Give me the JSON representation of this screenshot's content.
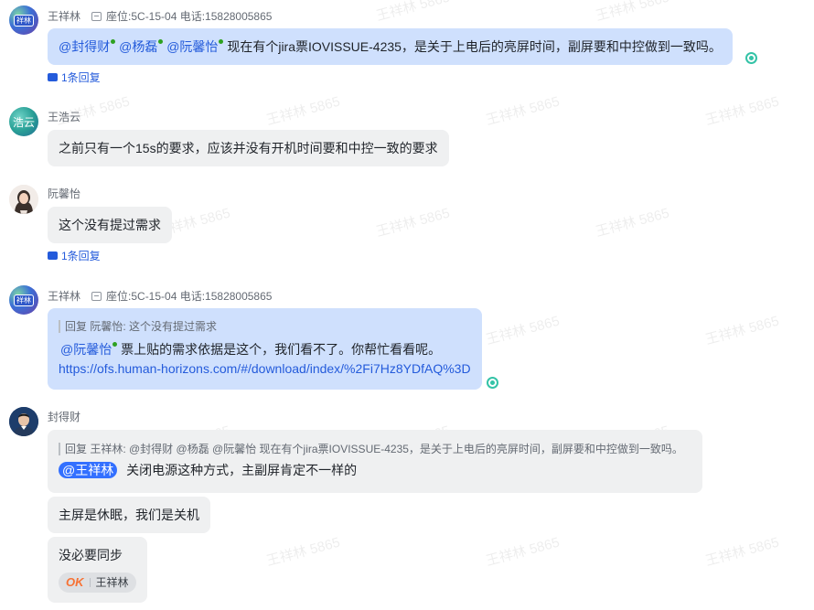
{
  "watermark": {
    "text": "王祥林 5865"
  },
  "messages": [
    {
      "sender": "王祥林",
      "signature": "座位:5C-15-04 电话:15828005865",
      "mentions": [
        "@封得财",
        "@杨磊",
        "@阮馨怡"
      ],
      "text": "现在有个jira票IOVISSUE-4235，是关于上电后的亮屏时间，副屏要和中控做到一致吗。",
      "reply_count": "1条回复"
    },
    {
      "sender": "王浩云",
      "avatar_text": "浩云",
      "text": "之前只有一个15s的要求，应该并没有开机时间要和中控一致的要求"
    },
    {
      "sender": "阮馨怡",
      "text": "这个没有提过需求",
      "reply_count": "1条回复"
    },
    {
      "sender": "王祥林",
      "signature": "座位:5C-15-04 电话:15828005865",
      "quote": "回复 阮馨怡:  这个没有提过需求",
      "mention": "@阮馨怡",
      "text": "票上贴的需求依据是这个，我们看不了。你帮忙看看呢。",
      "link": "https://ofs.human-horizons.com/#/download/index/%2Fi7Hz8YDfAQ%3D"
    },
    {
      "sender": "封得财",
      "quote": "回复 王祥林:  @封得财 @杨磊 @阮馨怡 现在有个jira票IOVISSUE-4235，是关于上电后的亮屏时间，副屏要和中控做到一致吗。",
      "mention": "@王祥林",
      "text": "关闭电源这种方式，主副屏肯定不一样的",
      "followups": [
        "主屏是休眠，我们是关机",
        "没必要同步"
      ],
      "reaction": {
        "emoji": "OK",
        "user": "王祥林"
      }
    }
  ],
  "avatar_wang_text": "祥林"
}
